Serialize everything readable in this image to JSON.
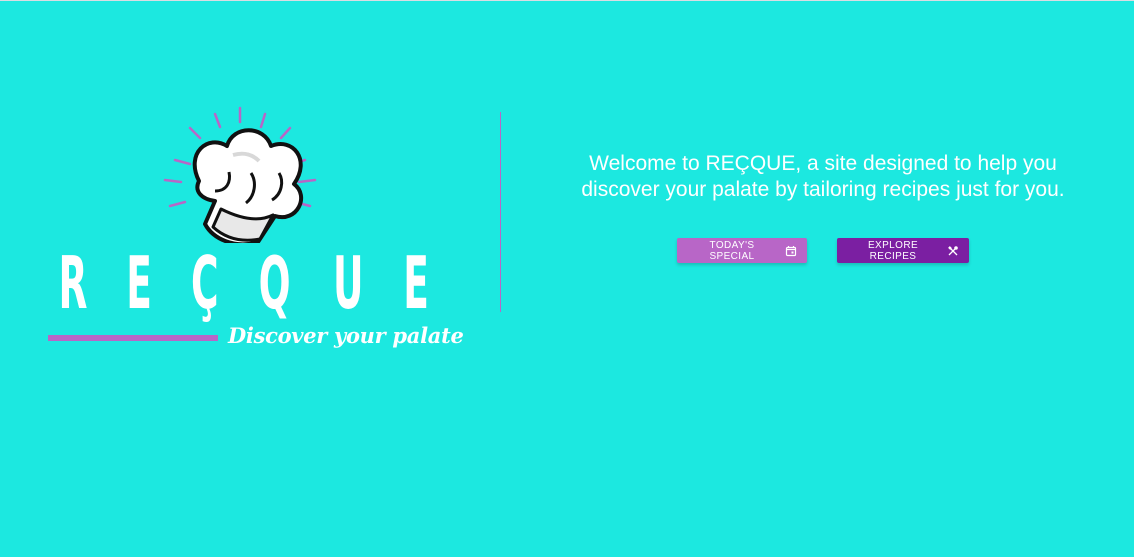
{
  "brand": {
    "name_letters": [
      "R",
      "E",
      "Ç",
      "Q",
      "U",
      "E"
    ],
    "tagline": "Discover your palate",
    "logo_icon": "chef-hat-icon"
  },
  "main": {
    "welcome_text": "Welcome to REÇQUE, a site designed to help you discover your palate by tailoring recipes just for you."
  },
  "actions": {
    "todays_special": {
      "label": "TODAY'S SPECIAL",
      "icon": "calendar-icon"
    },
    "explore_recipes": {
      "label": "EXPLORE RECIPES",
      "icon": "utensils-icon"
    }
  },
  "colors": {
    "background": "#1ce8e0",
    "accent": "#b866c7",
    "primary": "#7b1fa2",
    "text": "#ffffff"
  }
}
